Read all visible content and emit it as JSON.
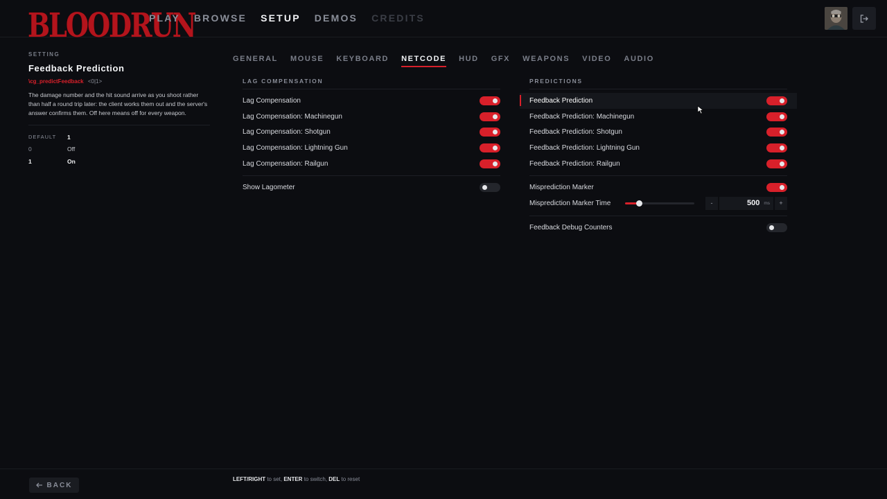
{
  "logo": {
    "text": "BLOODRUN"
  },
  "topnav": [
    {
      "label": "PLAY",
      "state": "normal"
    },
    {
      "label": "BROWSE",
      "state": "normal"
    },
    {
      "label": "SETUP",
      "state": "active"
    },
    {
      "label": "DEMOS",
      "state": "normal"
    },
    {
      "label": "CREDITS",
      "state": "disabled"
    }
  ],
  "info": {
    "kicker": "SETTING",
    "title": "Feedback Prediction",
    "cvar": "\\cg_predictFeedback",
    "range": "<0|1>",
    "description": "The damage number and the hit sound arrive as you shoot rather than half a round trip later: the client works them out and the server's answer confirms them. Off here means off for every weapon.",
    "default_label": "DEFAULT",
    "default_value": "1",
    "values": [
      {
        "key": "0",
        "label": "Off",
        "selected": false
      },
      {
        "key": "1",
        "label": "On",
        "selected": true
      }
    ]
  },
  "subtabs": [
    "GENERAL",
    "MOUSE",
    "KEYBOARD",
    "NETCODE",
    "HUD",
    "GFX",
    "WEAPONS",
    "VIDEO",
    "AUDIO"
  ],
  "active_subtab": "NETCODE",
  "lag": {
    "title": "LAG COMPENSATION",
    "items": [
      {
        "label": "Lag Compensation",
        "on": true
      },
      {
        "label": "Lag Compensation: Machinegun",
        "on": true
      },
      {
        "label": "Lag Compensation: Shotgun",
        "on": true
      },
      {
        "label": "Lag Compensation: Lightning Gun",
        "on": true
      },
      {
        "label": "Lag Compensation: Railgun",
        "on": true
      }
    ],
    "lagometer": {
      "label": "Show Lagometer",
      "on": false
    }
  },
  "predictions": {
    "title": "PREDICTIONS",
    "items": [
      {
        "label": "Feedback Prediction",
        "on": true
      },
      {
        "label": "Feedback Prediction: Machinegun",
        "on": true
      },
      {
        "label": "Feedback Prediction: Shotgun",
        "on": true
      },
      {
        "label": "Feedback Prediction: Lightning Gun",
        "on": true
      },
      {
        "label": "Feedback Prediction: Railgun",
        "on": true
      }
    ],
    "marker": {
      "label": "Misprediction Marker",
      "on": true
    },
    "marker_time": {
      "label": "Misprediction Marker Time",
      "value": "500",
      "unit": "ms",
      "level": 0.2,
      "minus": "-",
      "plus": "+"
    },
    "debug": {
      "label": "Feedback Debug Counters",
      "on": false
    }
  },
  "colors": {
    "accent": "#d8202a",
    "background": "#0c0d11"
  },
  "footer": {
    "back_label": "BACK",
    "hint_1_key": "LEFT/RIGHT",
    "hint_1_text": " to set, ",
    "hint_2_key": "ENTER",
    "hint_2_text": " to switch, ",
    "hint_3_key": "DEL",
    "hint_3_text": " to reset"
  }
}
